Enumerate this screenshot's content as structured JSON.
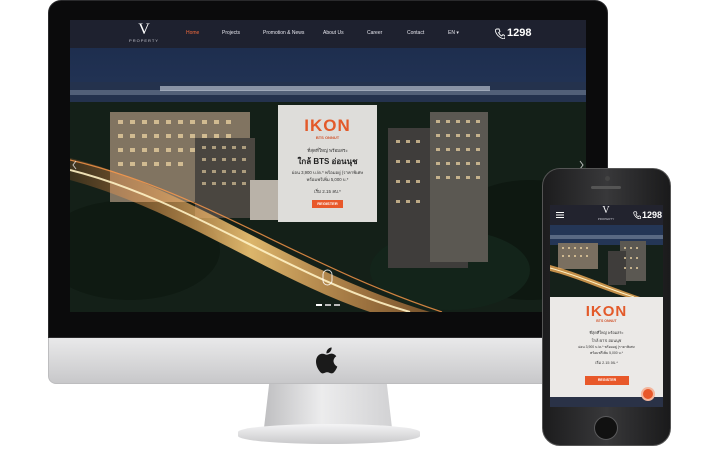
{
  "website": {
    "logo": {
      "letter": "V",
      "subtitle": "PROPERTY"
    },
    "nav": {
      "items": [
        "Home",
        "Projects",
        "Promotion & News",
        "About Us",
        "Career",
        "Contact",
        "EN ▾"
      ],
      "active": "Home"
    },
    "hotline": "1298",
    "promo": {
      "brand": "IKON",
      "subtitle": "BTS ONNUT",
      "line1": "ที่สุดที่ใหญ่ พร้อมสระ",
      "line2": "ใกล้ BTS อ่อนนุช",
      "line3": "ผ่อน 3,900 บ./ด.* พร้อมอยู่ (ราคาพิเศษ",
      "line4": "พร้อมฟรีเพิ่ม 5,000 บ.*",
      "price": "เริ่ม 2.15 ลบ.*",
      "register_label": "REGISTER"
    },
    "slider": {
      "count": 3,
      "active": 0
    }
  },
  "colors": {
    "accent": "#e8582a",
    "nav_bg": "#1f212d",
    "active_nav": "#f26a3d"
  },
  "icons": [
    "apple-icon",
    "phone-icon",
    "hamburger-menu-icon",
    "chat-icon",
    "chevron-down-icon"
  ]
}
